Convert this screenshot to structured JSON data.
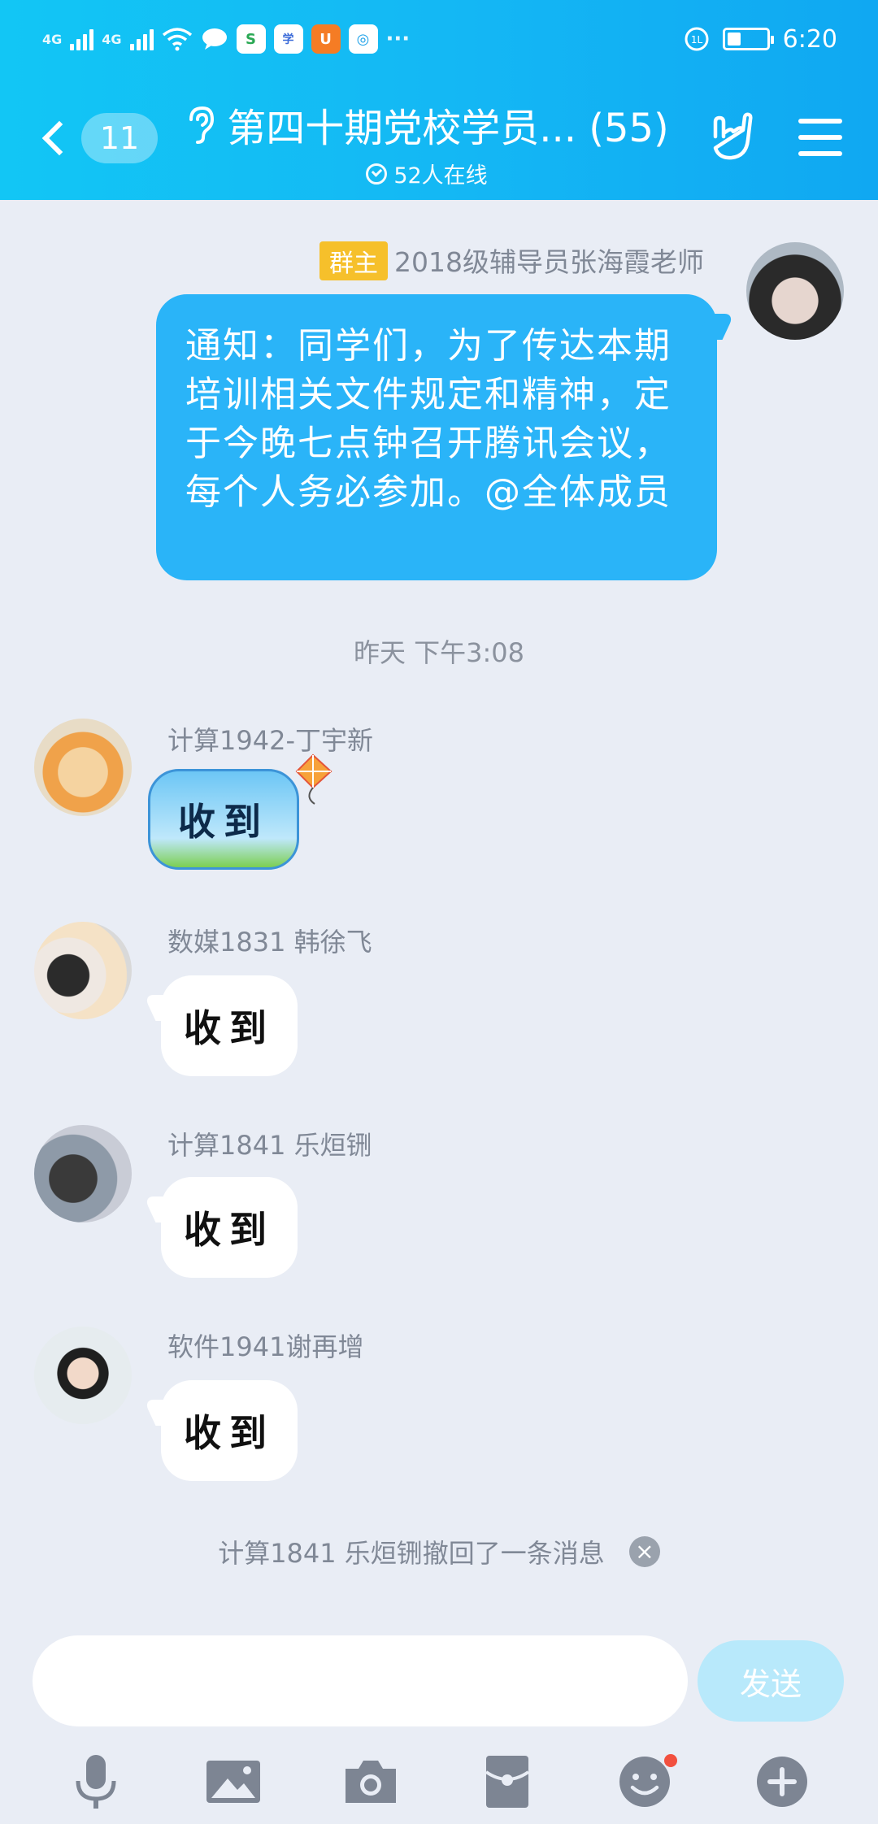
{
  "status_bar": {
    "net1": "4G",
    "net2": "4G",
    "time": "6:20",
    "more": "···",
    "battery_level": 0.35
  },
  "header": {
    "back_badge": "11",
    "title": "第四十期党校学员... (55)",
    "online": "52人在线"
  },
  "messages": {
    "owner": {
      "role": "群主",
      "name": "2018级辅导员张海霞老师",
      "text": "通知：同学们，为了传达本期培训相关文件规定和精神，定于今晚七点钟召开腾讯会议，每个人务必参加。@全体成员"
    },
    "time_divider": "昨天 下午3:08",
    "m1": {
      "name": "计算1942-丁宇新",
      "text": "收到"
    },
    "m2": {
      "name": "数媒1831 韩徐飞",
      "text": "收到"
    },
    "m3": {
      "name": "计算1841 乐烜铏",
      "text": "收到"
    },
    "m4": {
      "name": "软件1941谢再增",
      "text": "收到"
    },
    "recall": "计算1841 乐烜铏撤回了一条消息"
  },
  "input": {
    "placeholder": "",
    "send_label": "发送"
  },
  "toolbar": {
    "items": [
      "microphone-icon",
      "image-icon",
      "camera-icon",
      "red-packet-icon",
      "emoji-icon",
      "plus-icon"
    ]
  },
  "colors": {
    "header": "#14b8f4",
    "bubble_blue": "#2ab4f8",
    "background": "#e9edf5",
    "role_badge": "#f6c02b"
  }
}
